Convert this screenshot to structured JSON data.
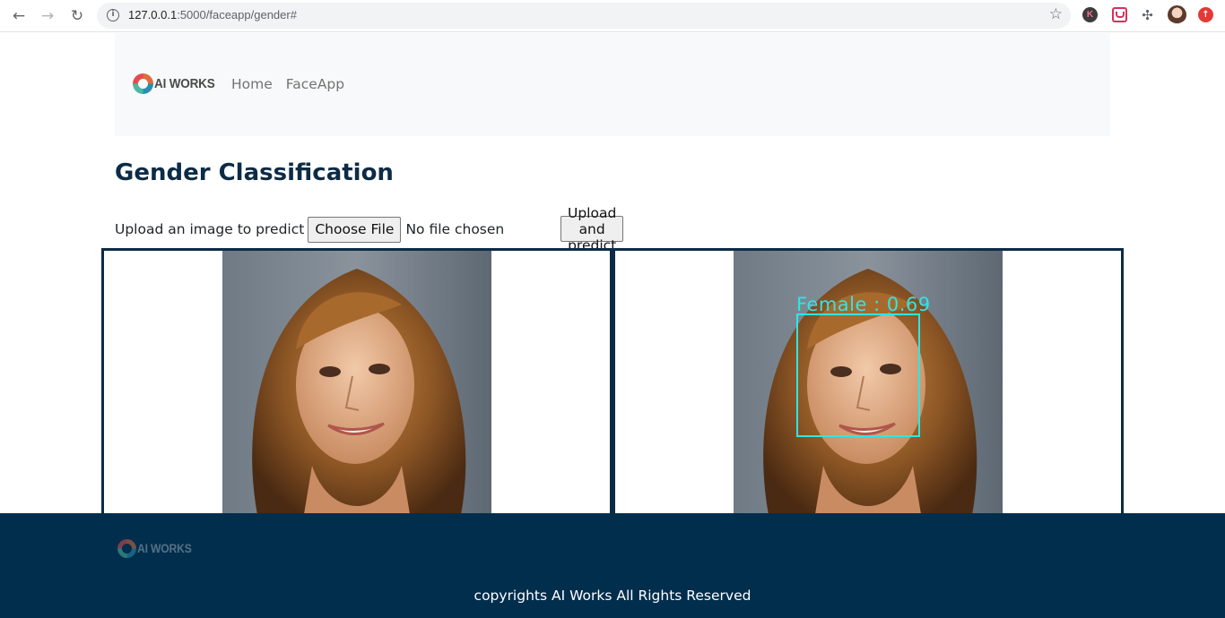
{
  "browser": {
    "url_host": "127.0.0.1",
    "url_rest": ":5000/faceapp/gender#",
    "icons": [
      "back-arrow-icon",
      "forward-arrow-icon",
      "reload-icon",
      "info-icon",
      "star-icon",
      "extension-k-icon",
      "pocket-icon",
      "puzzle-icon",
      "profile-avatar-icon",
      "update-icon"
    ],
    "ext_k_letter": "K"
  },
  "navbar": {
    "brand_text": "AI WORKS",
    "links": [
      "Home",
      "FaceApp"
    ]
  },
  "main": {
    "title": "Gender Classification",
    "upload_label": "Upload an image to predict",
    "choose_file_label": "Choose File",
    "file_status": "No file chosen",
    "submit_label": "Upload and predict"
  },
  "results": {
    "prediction_label": "Female : 0.69",
    "box_color": "#2ee6e6"
  },
  "footer": {
    "brand_text": "AI WORKS",
    "copyright": "copyrights AI Works All Rights Reserved"
  },
  "colors": {
    "primary_dark": "#0d2b45",
    "footer_bg": "#012e4d",
    "navbar_bg": "#f8f9fa"
  }
}
